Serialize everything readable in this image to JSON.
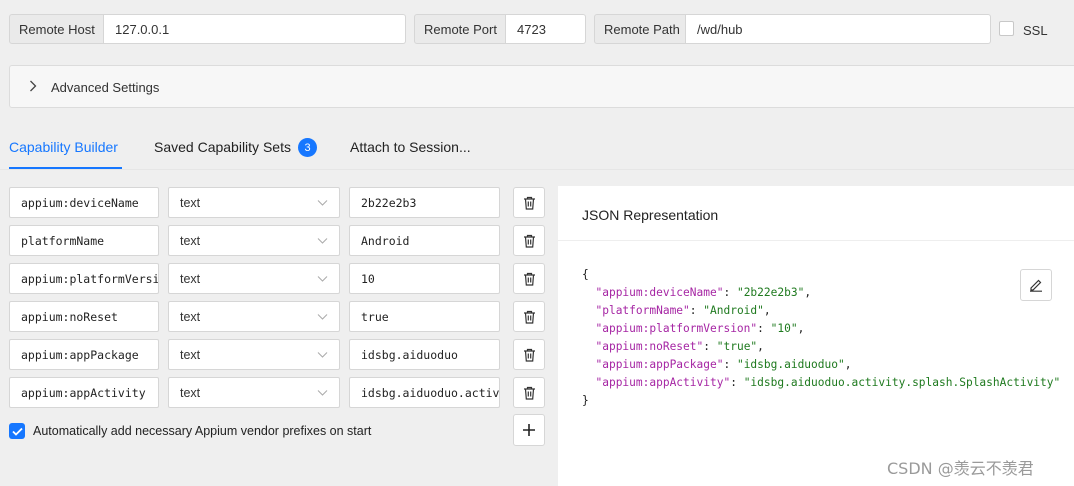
{
  "connection": {
    "host_label": "Remote Host",
    "host_value": "127.0.0.1",
    "port_label": "Remote Port",
    "port_value": "4723",
    "path_label": "Remote Path",
    "path_value": "/wd/hub",
    "ssl_label": "SSL",
    "ssl_checked": false
  },
  "advanced": {
    "label": "Advanced Settings",
    "expanded": false
  },
  "tabs": [
    {
      "label": "Capability Builder",
      "active": true
    },
    {
      "label": "Saved Capability Sets",
      "badge": "3"
    },
    {
      "label": "Attach to Session..."
    }
  ],
  "capabilities": [
    {
      "name": "appium:deviceName",
      "type": "text",
      "value": "2b22e2b3"
    },
    {
      "name": "platformName",
      "type": "text",
      "value": "Android"
    },
    {
      "name": "appium:platformVersion",
      "type": "text",
      "value": "10"
    },
    {
      "name": "appium:noReset",
      "type": "text",
      "value": "true"
    },
    {
      "name": "appium:appPackage",
      "type": "text",
      "value": "idsbg.aiduoduo"
    },
    {
      "name": "appium:appActivity",
      "type": "text",
      "value": "idsbg.aiduoduo.activity.splash.SplashActivity"
    }
  ],
  "auto_prefix": {
    "label": "Automatically add necessary Appium vendor prefixes on start",
    "checked": true
  },
  "json_panel": {
    "title": "JSON Representation",
    "open_brace": "{",
    "close_brace": "}",
    "entries": [
      {
        "key": "\"appium:deviceName\"",
        "value": "\"2b22e2b3\"",
        "sep": ": ",
        "end": ","
      },
      {
        "key": "\"platformName\"",
        "value": "\"Android\"",
        "sep": ": ",
        "end": ","
      },
      {
        "key": "\"appium:platformVersion\"",
        "value": "\"10\"",
        "sep": ": ",
        "end": ","
      },
      {
        "key": "\"appium:noReset\"",
        "value": "\"true\"",
        "sep": ": ",
        "end": ","
      },
      {
        "key": "\"appium:appPackage\"",
        "value": "\"idsbg.aiduoduo\"",
        "sep": ": ",
        "end": ","
      },
      {
        "key": "\"appium:appActivity\"",
        "value": "\"idsbg.aiduoduo.activity.splash.SplashActivity\"",
        "sep": ": ",
        "end": ""
      }
    ]
  },
  "watermark": "CSDN @羡云不羡君",
  "colors": {
    "accent": "#1677ff",
    "json_key": "#a626a4",
    "json_string": "#1f7a1f"
  },
  "icons": {
    "delete": "trash-icon",
    "add": "plus-icon",
    "edit": "pencil-icon",
    "expand": "chevron-right-icon",
    "select": "chevron-down-icon"
  }
}
